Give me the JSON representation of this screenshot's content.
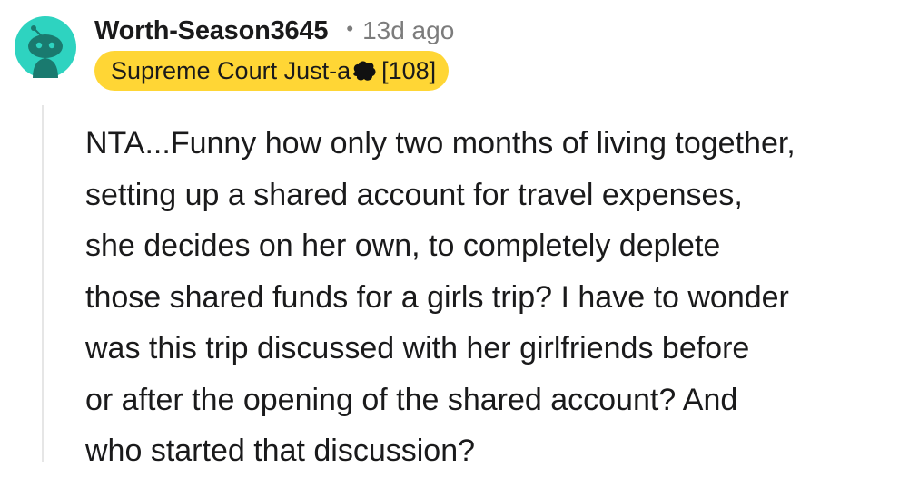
{
  "comment": {
    "author": {
      "username": "Worth-Season3645",
      "avatar_icon": "snoo-avatar-icon",
      "avatar_color": "#2ed3c0"
    },
    "separator": "•",
    "timestamp": "13d ago",
    "flair": {
      "text_before": "Supreme Court Just-a",
      "redaction_icon": "redaction-blob-icon",
      "text_after": "[108]",
      "background": "#ffd635"
    },
    "body_lines": [
      "NTA...Funny how only two months of living together,",
      "setting up a shared account for travel expenses,",
      "she decides on her own, to completely deplete",
      "those shared funds for a girls trip? I have to wonder",
      "was this trip discussed with her girlfriends before",
      "or after the opening of the shared account? And",
      "who started that discussion?"
    ]
  }
}
